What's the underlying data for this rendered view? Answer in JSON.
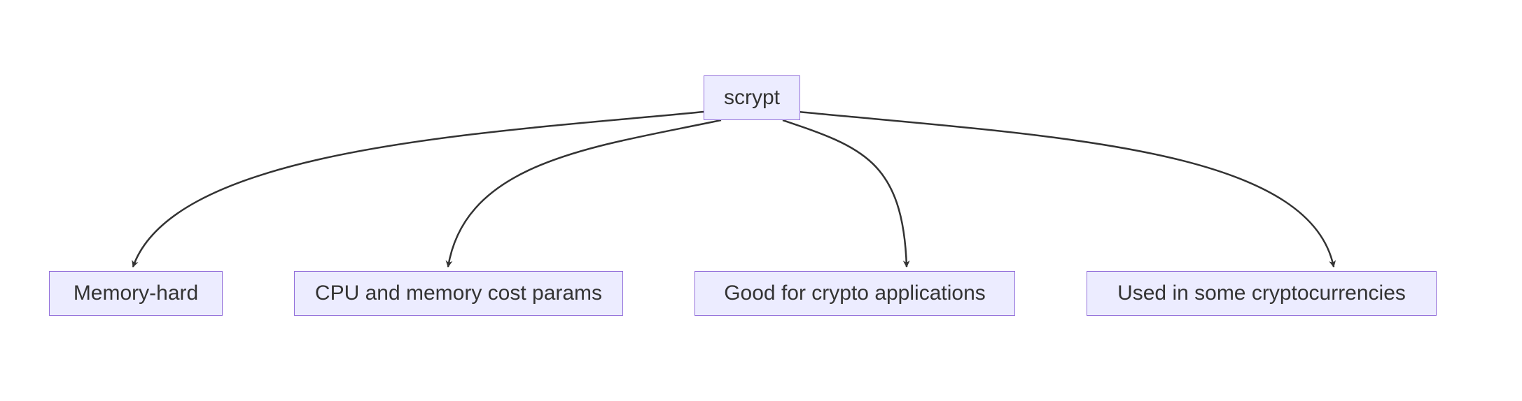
{
  "chart_data": {
    "type": "diagram",
    "root": {
      "id": "scrypt",
      "label": "scrypt"
    },
    "children": [
      {
        "id": "memory-hard",
        "label": "Memory-hard"
      },
      {
        "id": "cost-params",
        "label": "CPU and memory cost params"
      },
      {
        "id": "crypto-apps",
        "label": "Good for crypto applications"
      },
      {
        "id": "cryptocurrencies",
        "label": "Used in some cryptocurrencies"
      }
    ],
    "edges": [
      {
        "from": "scrypt",
        "to": "memory-hard"
      },
      {
        "from": "scrypt",
        "to": "cost-params"
      },
      {
        "from": "scrypt",
        "to": "crypto-apps"
      },
      {
        "from": "scrypt",
        "to": "cryptocurrencies"
      }
    ],
    "colors": {
      "node_fill": "#ECECFF",
      "node_stroke": "#9370DB",
      "edge_stroke": "#333333",
      "text": "#333333",
      "background": "#ffffff"
    }
  }
}
